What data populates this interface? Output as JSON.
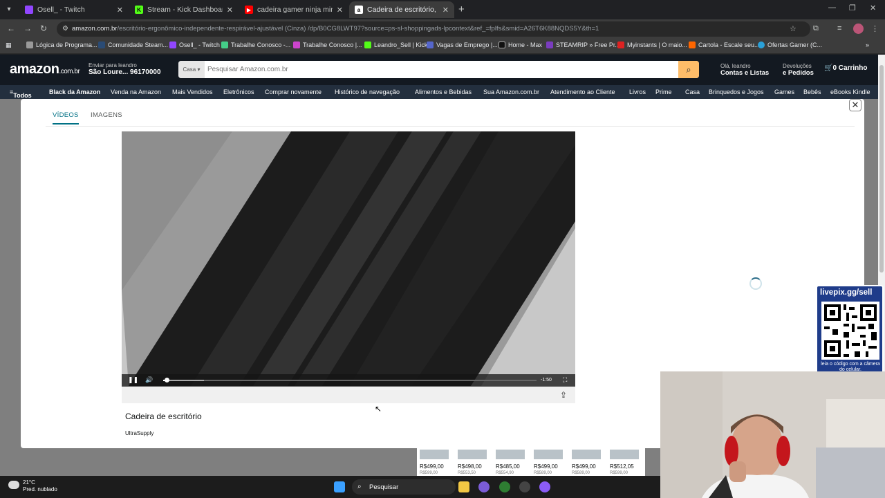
{
  "browser": {
    "tabs": [
      {
        "title": "Osell_ - Twitch",
        "color": "#9146ff"
      },
      {
        "title": "Stream - Kick Dashboard",
        "color": "#53fc18"
      },
      {
        "title": "cadeira gamer ninja minato rec",
        "color": "#ff0000"
      },
      {
        "title": "Cadeira de escritório, design er",
        "color": "#ffffff",
        "active": true
      }
    ],
    "url_host": "amazon.com.br",
    "url_path": "/escritório-ergonômico-independente-respirável-ajustável (Cinza) /dp/B0CG8LWT97?source=ps-sl-shoppingads-lpcontext&ref_=fplfs&smid=A26T6K88NQDS5Y&th=1",
    "bookmarks": [
      "Lógica de Programa...",
      "Comunidade Steam...",
      "Osell_ - Twitch",
      "Trabalhe Conosco -...",
      "Trabalhe Conosco |...",
      "Leandro_Sell | Kick",
      "Vagas de Emprego |...",
      "Home - Max",
      "STEAMRIP » Free Pr...",
      "Myinstants | O maio...",
      "Cartola - Escale seu...",
      "Ofertas Gamer (C..."
    ]
  },
  "amazon": {
    "logo": "amazon",
    "logo_suffix": ".com.br",
    "deliver_line1": "Enviar para leandro",
    "deliver_line2": "São Loure... 96170000",
    "search_category": "Casa",
    "search_placeholder": "Pesquisar Amazon.com.br",
    "account_line1": "Olá, leandro",
    "account_line2": "Contas e Listas",
    "returns_line1": "Devoluções",
    "returns_line2": "e Pedidos",
    "cart_count": "0",
    "cart_label": "Carrinho",
    "subnav": [
      "Todos",
      "Black da Amazon",
      "Venda na Amazon",
      "Mais Vendidos",
      "Eletrônicos",
      "Comprar novamente",
      "Histórico de navegação",
      "Alimentos e Bebidas",
      "Sua Amazon.com.br",
      "Atendimento ao Cliente",
      "Livros",
      "Prime",
      "Casa",
      "Brinquedos e Jogos",
      "Games",
      "Bebês",
      "eBooks Kindle"
    ]
  },
  "modal": {
    "tabs": [
      "VÍDEOS",
      "IMAGENS"
    ],
    "video_time": "-1:50",
    "video_progress": 0.01,
    "video_buffered": 0.11,
    "video_title": "Cadeira de escritório",
    "video_vendor": "UltraSupply"
  },
  "products": [
    {
      "price": "R$499,00",
      "old": "R$599,00"
    },
    {
      "price": "R$498,00",
      "old": "R$553,50"
    },
    {
      "price": "R$485,00",
      "old": "R$554,90"
    },
    {
      "price": "R$499,00",
      "old": "R$589,00"
    },
    {
      "price": "R$499,00",
      "old": "R$589,00"
    },
    {
      "price": "R$512,05",
      "old": "R$599,00"
    }
  ],
  "overlay": {
    "qr_title": "livepix.gg/sell",
    "qr_caption": "leia o código com a câmera do celular."
  },
  "taskbar": {
    "temp": "21°C",
    "weather": "Pred. nublado",
    "search_label": "Pesquisar"
  }
}
